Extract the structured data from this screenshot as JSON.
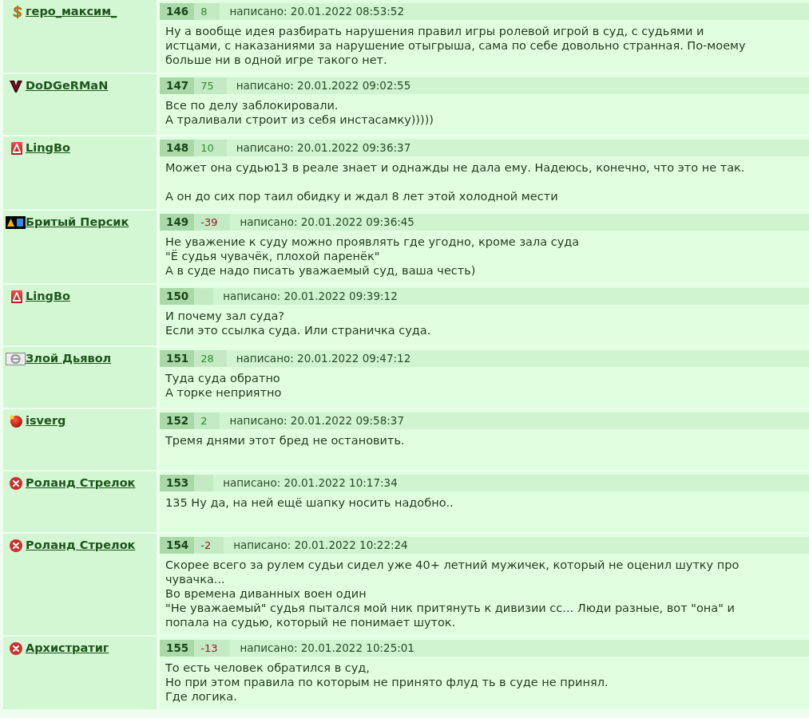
{
  "posts": [
    {
      "author": {
        "name": "геро_максим_"
      },
      "number": "146",
      "rating": {
        "text": "8",
        "color": "#2e8b2e"
      },
      "posted": "написано: 20.01.2022 08:53:52",
      "message": "Ну а вообще идея разбирать нарушения правил игры ролевой игрой в суд, с судьями и истцами, с наказаниями за нарушение отыгрыша, сама по себе довольно странная. По-моему больше ни в одной игре такого нет."
    },
    {
      "author": {
        "name": "DoDGeRMaN"
      },
      "number": "147",
      "rating": {
        "text": "75",
        "color": "#2e8b2e"
      },
      "posted": "написано: 20.01.2022 09:02:55",
      "message": "Все по делу заблокировали.\nА траливали строит из себя инстасамку)))))"
    },
    {
      "author": {
        "name": "LingBo"
      },
      "number": "148",
      "rating": {
        "text": "10",
        "color": "#2e8b2e"
      },
      "posted": "написано: 20.01.2022 09:36:37",
      "message": "Может она судью13 в реале знает и однажды не дала ему. Надеюсь, конечно, что это не так.\n\nА он до сих пор таил обидку и ждал 8 лет этой холодной мести"
    },
    {
      "author": {
        "name": "Бритый Персик"
      },
      "number": "149",
      "rating": {
        "text": "-39",
        "color": "#8b2020"
      },
      "posted": "написано: 20.01.2022 09:36:45",
      "message": "Не уважение к суду можно проявлять где угодно, кроме зала суда\n\"Ё судья чувачёк, плохой паренёк\"\nА в суде надо писать уважаемый суд, ваша честь)"
    },
    {
      "author": {
        "name": "LingBo"
      },
      "number": "150",
      "posted": "написано: 20.01.2022 09:39:12",
      "message": "И почему зал суда?\nЕсли это ссылка суда. Или страничка суда."
    },
    {
      "author": {
        "name": "Злой Дьявол"
      },
      "number": "151",
      "rating": {
        "text": "28",
        "color": "#2e8b2e"
      },
      "posted": "написано: 20.01.2022 09:47:12",
      "message": "Туда суда обратно\nА торке неприятно"
    },
    {
      "author": {
        "name": "isverg"
      },
      "number": "152",
      "rating": {
        "text": "2",
        "color": "#2e8b2e"
      },
      "posted": "написано: 20.01.2022 09:58:37",
      "message": "Тремя днями этот бред не остановить."
    },
    {
      "author": {
        "name": "Роланд Стрелок"
      },
      "number": "153",
      "posted": "написано: 20.01.2022 10:17:34",
      "message": "135 Ну да, на ней ещё шапку носить надобно.."
    },
    {
      "author": {
        "name": "Роланд Стрелок"
      },
      "number": "154",
      "rating": {
        "text": "-2",
        "color": "#8b2020"
      },
      "posted": "написано: 20.01.2022 10:22:24",
      "message": "Скорее всего за рулем судьи сидел уже 40+ летний мужичек, который не оценил шутку про чувачка...\nВо времена диванных воен один\n\"Не уважаемый\" судья пытался мой ник притянуть к дивизии сс... Люди разные, вот \"она\" и попала на судью, который не понимает шуток."
    },
    {
      "author": {
        "name": "Архистратиг"
      },
      "number": "155",
      "rating": {
        "text": "-13",
        "color": "#8b2020"
      },
      "posted": "написано: 20.01.2022 10:25:01",
      "message": "То есть человек обратился в суд,\nНо при этом правила по которым не принято флуд ть в суде не принял.\nГде логика."
    }
  ]
}
